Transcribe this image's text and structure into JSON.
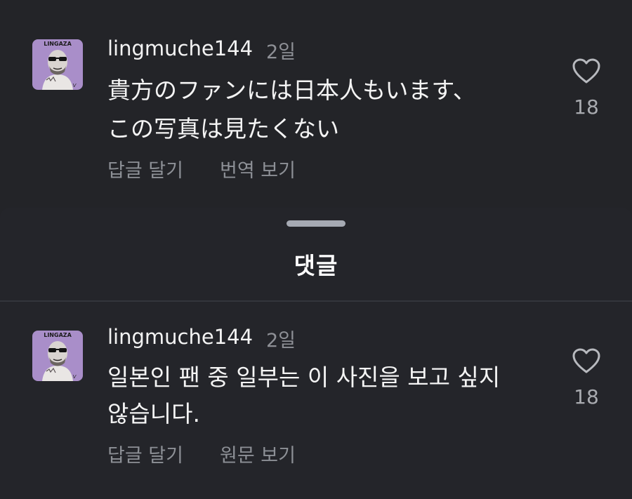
{
  "top_comment": {
    "username": "lingmuche144",
    "time": "2일",
    "lines": [
      "貴方のファンには日本人もいます、",
      "この写真は見たくない"
    ],
    "reply_label": "답글 달기",
    "toggle_label": "번역 보기",
    "like_count": "18",
    "avatar_text": "LINGAZA"
  },
  "sheet": {
    "title": "댓글"
  },
  "bottom_comment": {
    "username": "lingmuche144",
    "time": "2일",
    "lines": [
      "일본인 팬 중 일부는 이 사진을 보고 싶지",
      "않습니다."
    ],
    "reply_label": "답글 달기",
    "toggle_label": "원문 보기",
    "like_count": "18",
    "avatar_text": "LINGAZA"
  },
  "colors": {
    "background": "#232428",
    "muted_text": "#8d9096",
    "avatar_bg": "#a98ec9"
  }
}
